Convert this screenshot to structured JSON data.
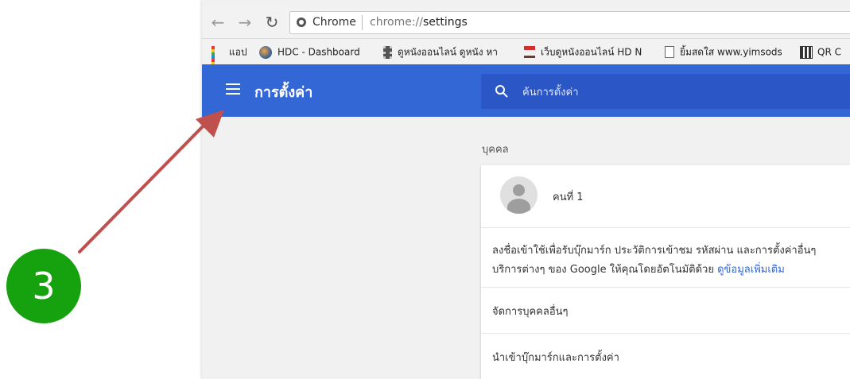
{
  "browser": {
    "back_icon": "arrow-left-icon",
    "forward_icon": "arrow-right-icon",
    "reload_icon": "reload-icon",
    "omnibox": {
      "chip_label": "Chrome",
      "url_scheme": "chrome://",
      "url_path": "settings"
    }
  },
  "bookmarks": [
    {
      "label": "แอป",
      "icon": "apps-grid-icon"
    },
    {
      "label": "HDC - Dashboard",
      "icon": "globe-icon"
    },
    {
      "label": "ดูหนังออนไลน์ ดูหนัง หา",
      "icon": "film-icon"
    },
    {
      "label": "เว็บดูหนังออนไลน์ HD N",
      "icon": "director-chair-icon"
    },
    {
      "label": "ยิ้มสดใส www.yimsods",
      "icon": "page-icon"
    },
    {
      "label": "QR C",
      "icon": "qr-code-icon"
    }
  ],
  "settings": {
    "title": "การตั้งค่า",
    "search_placeholder": "ค้นการตั้งค่า",
    "accent_color": "#3367d6"
  },
  "people": {
    "section_title": "บุคคล",
    "profile_name": "คนที่ 1",
    "description_line1": "ลงชื่อเข้าใช้เพื่อรับบุ๊กมาร์ก ประวัติการเข้าชม รหัสผ่าน และการตั้งค่าอื่นๆ",
    "description_line2": "บริการต่างๆ ของ Google ให้คุณโดยอัตโนมัติด้วย",
    "learn_more": "ดูข้อมูลเพิ่มเติม",
    "manage_people": "จัดการบุคคลอื่นๆ",
    "import_bookmarks": "นำเข้าบุ๊กมาร์กและการตั้งค่า"
  },
  "annotation": {
    "step_number": "3",
    "badge_color": "#16a20f",
    "arrow_color": "#c0504d"
  }
}
